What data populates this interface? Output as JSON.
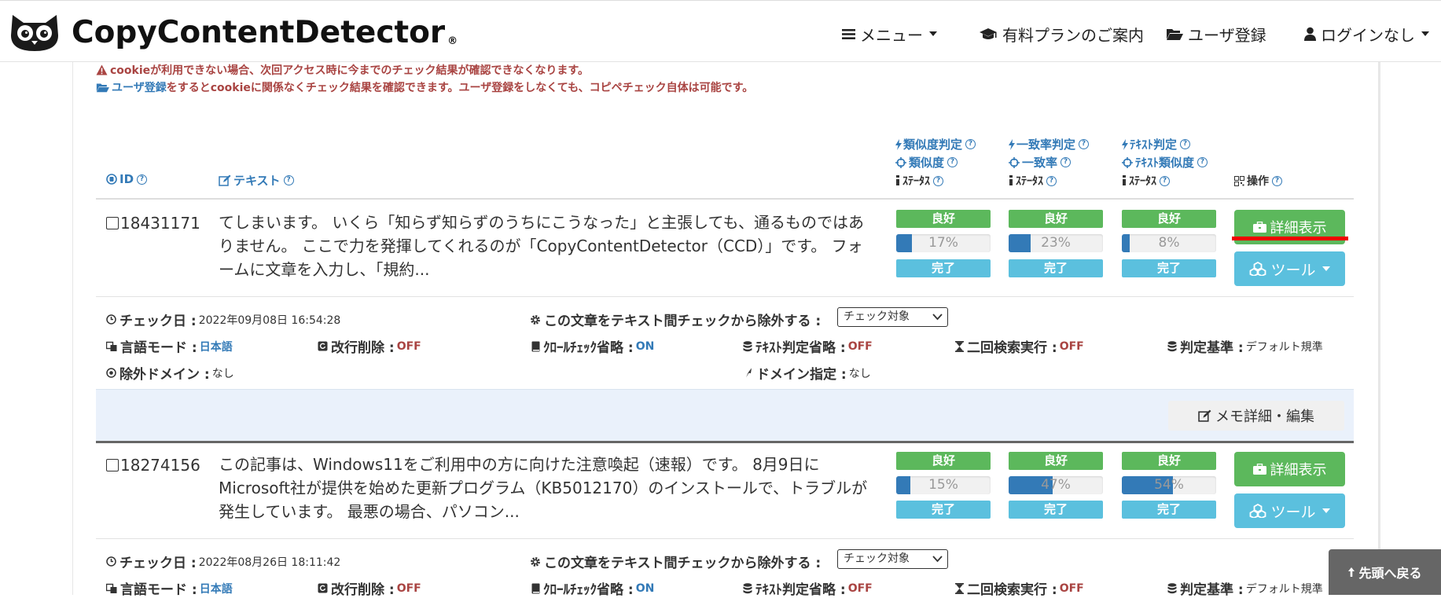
{
  "header": {
    "logo_text": "CopyContentDetector",
    "logo_reg": "®",
    "nav": {
      "menu": "メニュー",
      "plan": "有料プランのご案内",
      "register": "ユーザ登録",
      "login": "ログインなし"
    }
  },
  "notices": {
    "cookie_warning": "cookieが利用できない場合、次回アクセス時に今までのチェック結果が確認できなくなります。",
    "register_link": "ユーザ登録",
    "register_text": "をするとcookieに関係なくチェック結果を確認できます。ユーザ登録をしなくても、コピペチェック自体は可能です。"
  },
  "table_header": {
    "id": "ID",
    "text": "テキスト",
    "col1": {
      "line1": "類似度判定",
      "line2": "類似度",
      "line3": "ｽﾃｰﾀｽ"
    },
    "col2": {
      "line1": "一致率判定",
      "line2": "一致率",
      "line3": "ｽﾃｰﾀｽ"
    },
    "col3": {
      "line1": "ﾃｷｽﾄ判定",
      "line2": "ﾃｷｽﾄ類似度",
      "line3": "ｽﾃｰﾀｽ"
    },
    "actions": "操作"
  },
  "labels": {
    "good": "良好",
    "done": "完了",
    "detail_button": "詳細表示",
    "tool_button": "ツール",
    "check_date": "チェック日 :",
    "exclude_label": "この文章をテキスト間チェックから除外する :",
    "lang_mode": "言語モード :",
    "newline_delete": "改行削除 :",
    "crawl_skip": "ｸﾛｰﾙﾁｪｯｸ省略 :",
    "text_judge_skip": "ﾃｷｽﾄ判定省略 :",
    "second_search": "二回検索実行 :",
    "judge_basis": "判定基準 :",
    "exclude_domain": "除外ドメイン :",
    "domain_spec": "ドメイン指定 :",
    "memo_button": "メモ詳細・編集",
    "back_to_top": "先頭へ戻る"
  },
  "rows": [
    {
      "id": "18431171",
      "text": "てしまいます。 いくら「知らず知らずのうちにこうなった」と主張しても、通るものではありません。 ここで力を発揮してくれるのが「CopyContentDetector（CCD）」です。 フォームに文章を入力し、「規約...",
      "similarity": 17,
      "similarity_label": "17%",
      "match_rate": 23,
      "match_rate_label": "23%",
      "text_similarity": 8,
      "text_similarity_label": "8%",
      "check_date": "2022年09月08日 16:54:28",
      "exclude_select": "チェック対象",
      "lang": "日本語",
      "newline": "OFF",
      "crawl": "ON",
      "textjudge": "OFF",
      "second": "OFF",
      "basis": "デフォルト規準",
      "exclude_domain": "なし",
      "domain": "なし"
    },
    {
      "id": "18274156",
      "text": "この記事は、Windows11をご利用中の方に向けた注意喚起（速報）です。 8月9日にMicrosoft社が提供を始めた更新プログラム（KB5012170）のインストールで、トラブルが発生しています。 最悪の場合、パソコン...",
      "similarity": 15,
      "similarity_label": "15%",
      "match_rate": 47,
      "match_rate_label": "47%",
      "text_similarity": 54,
      "text_similarity_label": "54%",
      "check_date": "2022年08月26日 18:11:42",
      "exclude_select": "チェック対象",
      "lang": "日本語",
      "newline": "OFF",
      "crawl": "ON",
      "textjudge": "OFF",
      "second": "OFF",
      "basis": "デフォルト規準"
    }
  ]
}
